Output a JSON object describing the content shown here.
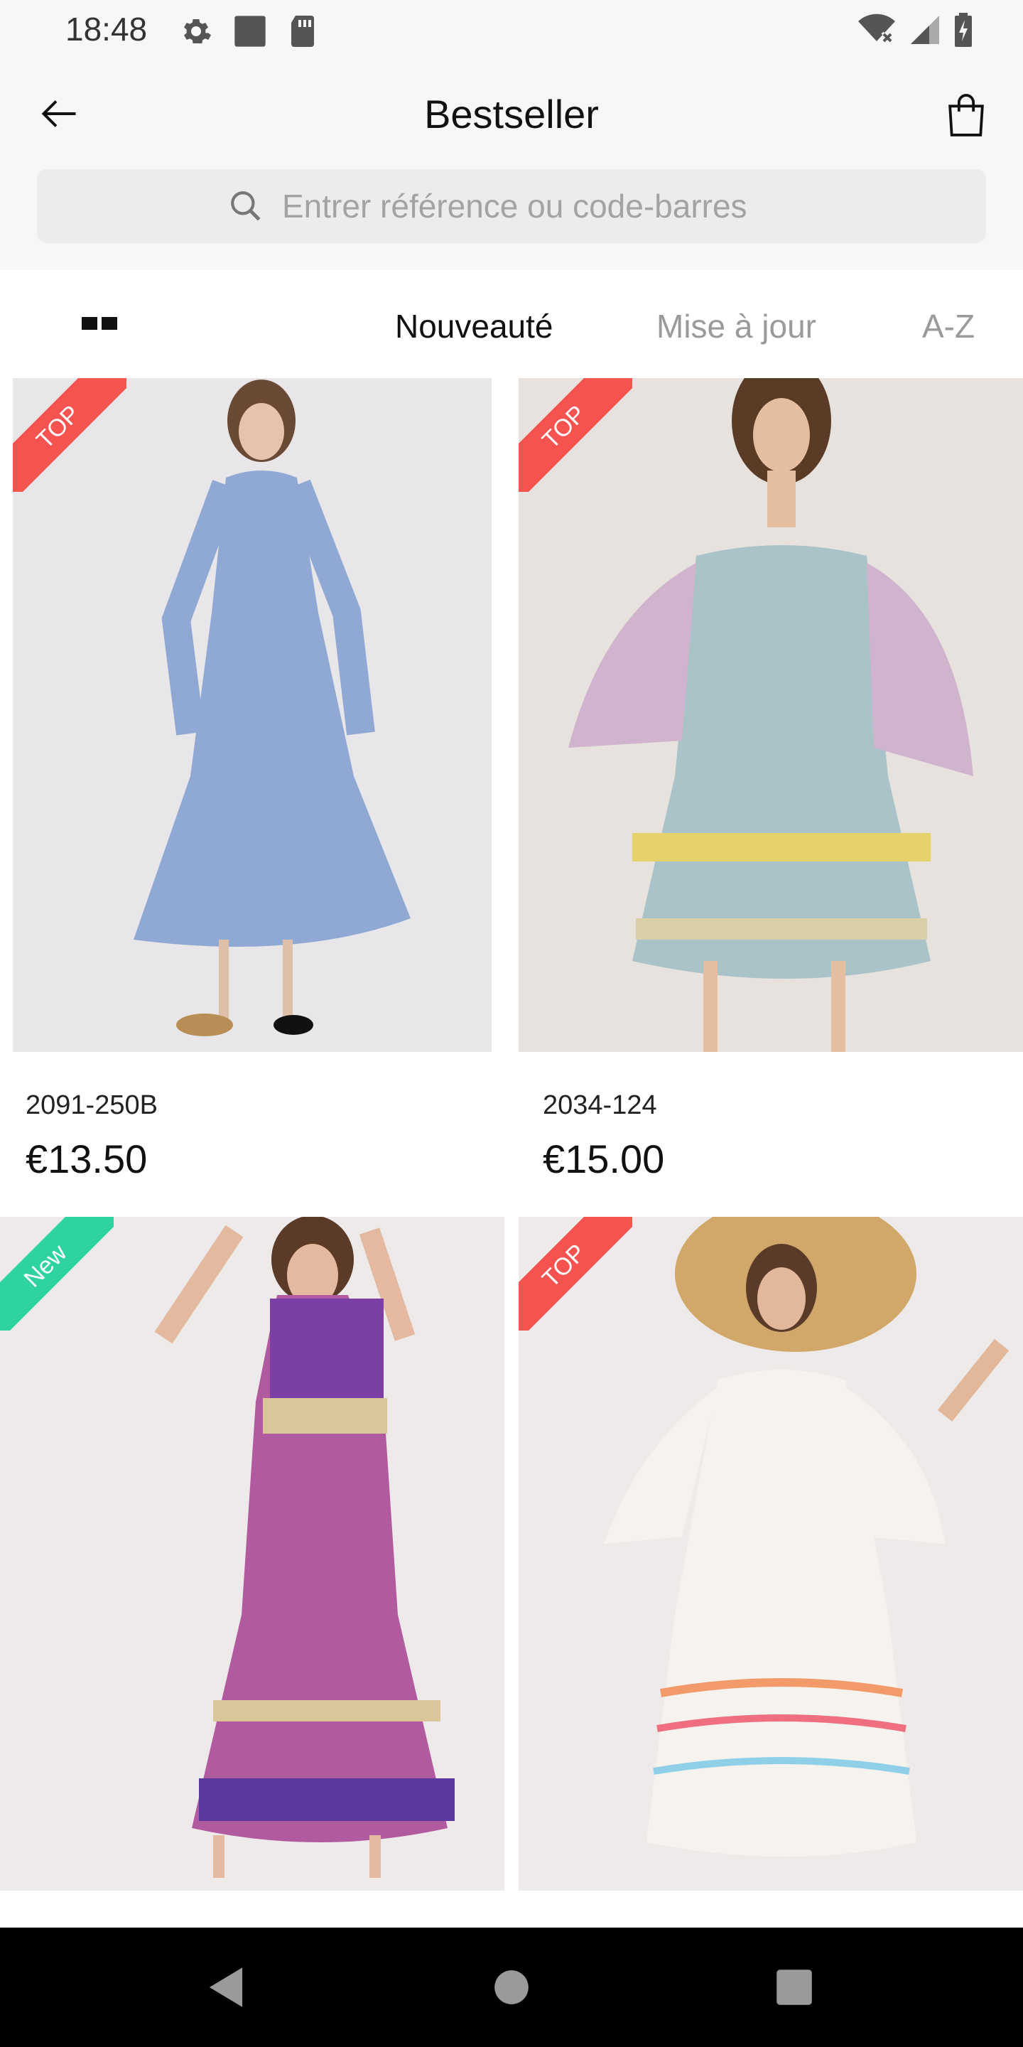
{
  "status_bar": {
    "time": "18:48"
  },
  "header": {
    "title": "Bestseller",
    "search_placeholder": "Entrer référence ou code-barres"
  },
  "sort": {
    "options": [
      "Nouveauté",
      "Mise à jour",
      "A-Z"
    ],
    "active": "Nouveauté"
  },
  "products": [
    {
      "badge": "TOP",
      "badge_color": "#f4534f",
      "ref": "2091-250B",
      "price": "€13.50",
      "dress_color": "#8fa9d4"
    },
    {
      "badge": "TOP",
      "badge_color": "#f4534f",
      "ref": "2034-124",
      "price": "€15.00",
      "dress_color": "#a9c3c9"
    },
    {
      "badge": "New",
      "badge_color": "#2ed3a0",
      "ref": "",
      "price": "",
      "dress_color": "#b15aa0"
    },
    {
      "badge": "TOP",
      "badge_color": "#f4534f",
      "ref": "",
      "price": "",
      "dress_color": "#f6f3ef"
    }
  ]
}
